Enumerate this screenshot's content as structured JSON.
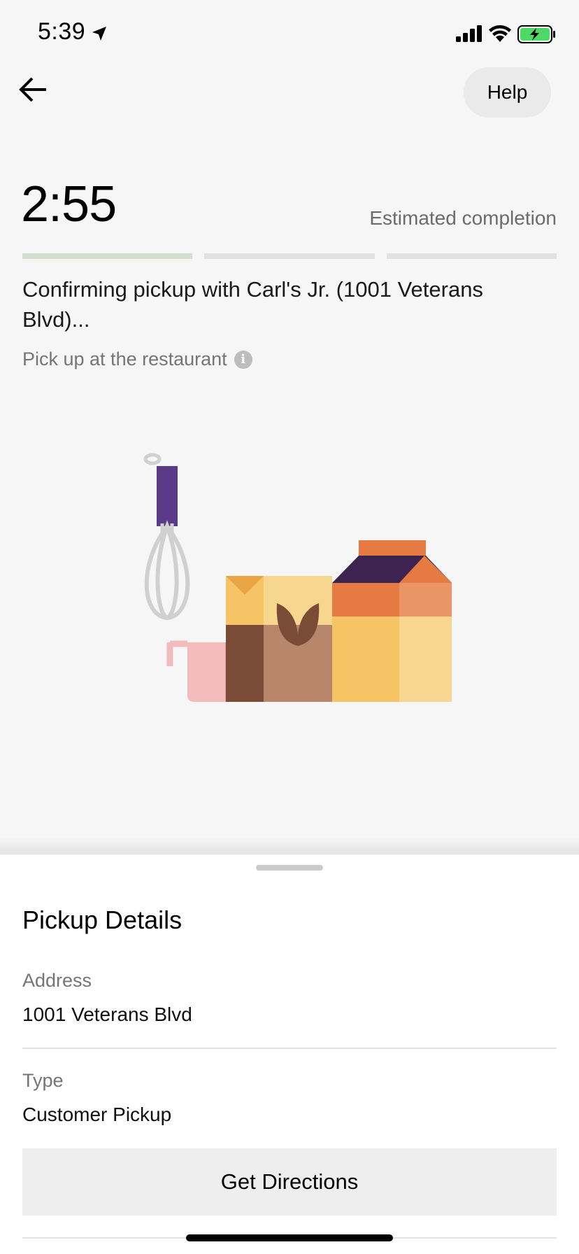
{
  "status_bar": {
    "time": "5:39",
    "icons": [
      "location-arrow-icon",
      "cellular-signal-icon",
      "wifi-icon",
      "battery-charging-icon"
    ],
    "battery_color": "#4cd964"
  },
  "header": {
    "back_icon": "arrow-left-icon",
    "help_label": "Help"
  },
  "eta": {
    "time": "2:55",
    "label": "Estimated completion",
    "progress_segments": 3,
    "active_segment": 1,
    "active_color": "#d3dccd"
  },
  "status": {
    "message": "Confirming pickup with Carl's Jr. (1001 Veterans Blvd)...",
    "sub_message": "Pick up at the restaurant",
    "info_icon": "info-icon"
  },
  "illustration": {
    "name": "baking-ingredients-illustration",
    "colors": {
      "whisk_handle": "#5b3a87",
      "cup": "#f2bcbc",
      "box": "#b8866a",
      "carton_top": "#3d2450",
      "carton_orange": "#e57b42",
      "carton_yellow": "#f6c465"
    }
  },
  "pickup_details": {
    "title": "Pickup Details",
    "address_label": "Address",
    "address_value": "1001 Veterans Blvd",
    "type_label": "Type",
    "type_value": "Customer Pickup",
    "directions_button": "Get Directions"
  }
}
